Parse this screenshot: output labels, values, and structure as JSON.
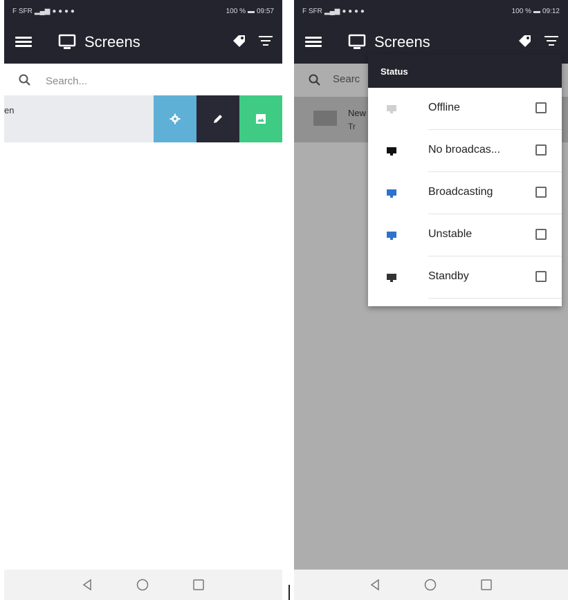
{
  "left_screen": {
    "status_bar": {
      "carrier": "F SFR",
      "battery": "100 %",
      "time": "09:57"
    },
    "app_bar": {
      "title": "Screens"
    },
    "search": {
      "placeholder": "Search..."
    },
    "row": {
      "visible_text": "en"
    }
  },
  "right_screen": {
    "status_bar": {
      "carrier": "F SFR",
      "battery": "100 %",
      "time": "09:12"
    },
    "app_bar": {
      "title": "Screens"
    },
    "background": {
      "search_text": "Searc",
      "item_name": "New",
      "item_sub": "Tr"
    },
    "filter_dropdown": {
      "header": "Status",
      "options": [
        {
          "label": "Offline",
          "icon": "monitor-offline-icon",
          "color": "#d0d0d0",
          "checked": false
        },
        {
          "label": "No broadcas...",
          "icon": "monitor-no-broadcast-icon",
          "color": "#111111",
          "checked": false
        },
        {
          "label": "Broadcasting",
          "icon": "monitor-broadcasting-icon",
          "color": "#2f72c9",
          "checked": false
        },
        {
          "label": "Unstable",
          "icon": "monitor-unstable-icon",
          "color": "#2f72c9",
          "checked": false
        },
        {
          "label": "Standby",
          "icon": "monitor-standby-icon",
          "color": "#333333",
          "checked": false
        }
      ]
    }
  },
  "colors": {
    "app_bar": "#23242d",
    "settings_action": "#5fb0d7",
    "edit_action": "#282934",
    "image_action": "#3fcb84",
    "overlay": "rgba(0,0,0,0.32)"
  }
}
